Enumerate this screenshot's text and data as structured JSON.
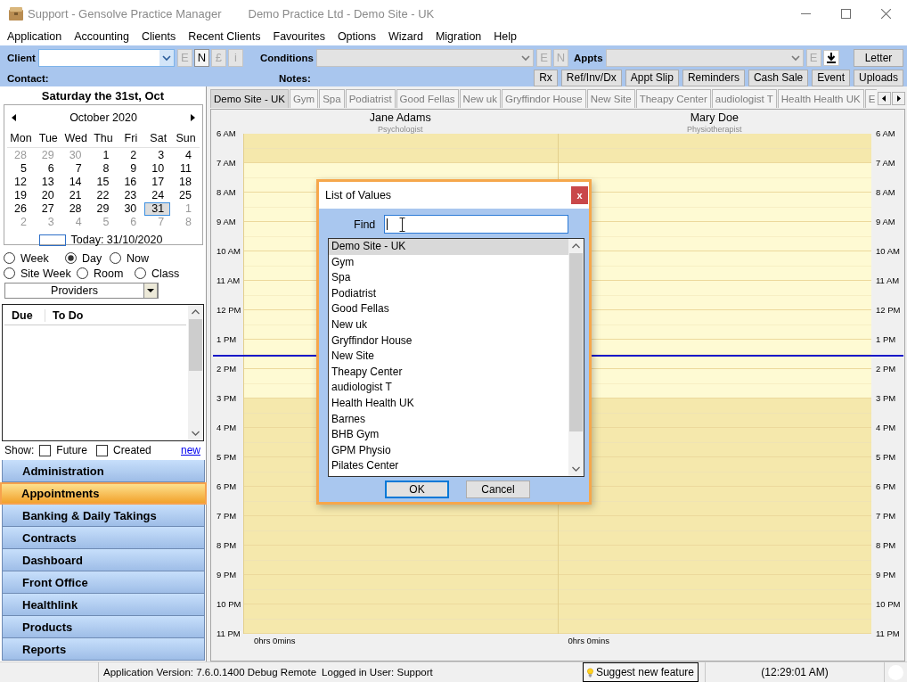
{
  "window": {
    "app_title": "Support - Gensolve Practice Manager",
    "document_title": "Demo Practice Ltd - Demo Site - UK"
  },
  "menu": [
    "Application",
    "Accounting",
    "Clients",
    "Recent Clients",
    "Favourites",
    "Options",
    "Wizard",
    "Migration",
    "Help"
  ],
  "toolbar": {
    "fields": [
      {
        "label": "Client",
        "disabled": false,
        "buttons": [
          {
            "label": "E",
            "disabled": true
          },
          {
            "label": "N",
            "disabled": false
          },
          {
            "label": "£",
            "disabled": true
          },
          {
            "label": "i",
            "disabled": true
          }
        ]
      },
      {
        "label": "Conditions",
        "disabled": true,
        "buttons": [
          {
            "label": "E",
            "disabled": true
          },
          {
            "label": "N",
            "disabled": true
          }
        ]
      },
      {
        "label": "Appts",
        "disabled": true,
        "buttons": [
          {
            "label": "E",
            "disabled": true
          }
        ]
      }
    ],
    "letter_button": "Letter",
    "contact_label": "Contact:",
    "notes_label": "Notes:",
    "actions": [
      "Rx",
      "Ref/Inv/Dx",
      "Appt Slip",
      "Reminders",
      "Cash Sale",
      "Event",
      "Uploads"
    ]
  },
  "date_heading": "Saturday the 31st, Oct",
  "calendar": {
    "month": "October 2020",
    "weekdays": [
      "Mon",
      "Tue",
      "Wed",
      "Thu",
      "Fri",
      "Sat",
      "Sun"
    ],
    "weeks": [
      [
        {
          "day": "28",
          "other_month": true,
          "selected": false
        },
        {
          "day": "29",
          "other_month": true,
          "selected": false
        },
        {
          "day": "30",
          "other_month": true,
          "selected": false
        },
        {
          "day": "1",
          "other_month": false,
          "selected": false
        },
        {
          "day": "2",
          "other_month": false,
          "selected": false
        },
        {
          "day": "3",
          "other_month": false,
          "selected": false
        },
        {
          "day": "4",
          "other_month": false,
          "selected": false
        }
      ],
      [
        {
          "day": "5",
          "other_month": false,
          "selected": false
        },
        {
          "day": "6",
          "other_month": false,
          "selected": false
        },
        {
          "day": "7",
          "other_month": false,
          "selected": false
        },
        {
          "day": "8",
          "other_month": false,
          "selected": false
        },
        {
          "day": "9",
          "other_month": false,
          "selected": false
        },
        {
          "day": "10",
          "other_month": false,
          "selected": false
        },
        {
          "day": "11",
          "other_month": false,
          "selected": false
        }
      ],
      [
        {
          "day": "12",
          "other_month": false,
          "selected": false
        },
        {
          "day": "13",
          "other_month": false,
          "selected": false
        },
        {
          "day": "14",
          "other_month": false,
          "selected": false
        },
        {
          "day": "15",
          "other_month": false,
          "selected": false
        },
        {
          "day": "16",
          "other_month": false,
          "selected": false
        },
        {
          "day": "17",
          "other_month": false,
          "selected": false
        },
        {
          "day": "18",
          "other_month": false,
          "selected": false
        }
      ],
      [
        {
          "day": "19",
          "other_month": false,
          "selected": false
        },
        {
          "day": "20",
          "other_month": false,
          "selected": false
        },
        {
          "day": "21",
          "other_month": false,
          "selected": false
        },
        {
          "day": "22",
          "other_month": false,
          "selected": false
        },
        {
          "day": "23",
          "other_month": false,
          "selected": false
        },
        {
          "day": "24",
          "other_month": false,
          "selected": false
        },
        {
          "day": "25",
          "other_month": false,
          "selected": false
        }
      ],
      [
        {
          "day": "26",
          "other_month": false,
          "selected": false
        },
        {
          "day": "27",
          "other_month": false,
          "selected": false
        },
        {
          "day": "28",
          "other_month": false,
          "selected": false
        },
        {
          "day": "29",
          "other_month": false,
          "selected": false
        },
        {
          "day": "30",
          "other_month": false,
          "selected": false
        },
        {
          "day": "31",
          "other_month": false,
          "selected": true
        },
        {
          "day": "1",
          "other_month": true,
          "selected": false
        }
      ],
      [
        {
          "day": "2",
          "other_month": true,
          "selected": false
        },
        {
          "day": "3",
          "other_month": true,
          "selected": false
        },
        {
          "day": "4",
          "other_month": true,
          "selected": false
        },
        {
          "day": "5",
          "other_month": true,
          "selected": false
        },
        {
          "day": "6",
          "other_month": true,
          "selected": false
        },
        {
          "day": "7",
          "other_month": true,
          "selected": false
        },
        {
          "day": "8",
          "other_month": true,
          "selected": false
        }
      ]
    ],
    "today_label": "Today: 31/10/2020"
  },
  "view_options": [
    [
      {
        "label": "Week",
        "selected": false
      },
      {
        "label": "Day",
        "selected": true
      },
      {
        "label": "Now",
        "selected": false
      }
    ],
    [
      {
        "label": "Site Week",
        "selected": false
      },
      {
        "label": "Room",
        "selected": false
      },
      {
        "label": "Class",
        "selected": false
      }
    ]
  ],
  "providers_dropdown": "Providers",
  "todo": {
    "columns": [
      "Due",
      "To Do"
    ]
  },
  "show_filter": {
    "label": "Show:",
    "options": [
      {
        "label": "Future",
        "checked": false
      },
      {
        "label": "Created",
        "checked": false
      }
    ],
    "link": "new"
  },
  "modules": [
    {
      "label": "Administration",
      "selected": false
    },
    {
      "label": "Appointments",
      "selected": true
    },
    {
      "label": "Banking & Daily Takings",
      "selected": false
    },
    {
      "label": "Contracts",
      "selected": false
    },
    {
      "label": "Dashboard",
      "selected": false
    },
    {
      "label": "Front Office",
      "selected": false
    },
    {
      "label": "Healthlink",
      "selected": false
    },
    {
      "label": "Products",
      "selected": false
    },
    {
      "label": "Reports",
      "selected": false
    }
  ],
  "site_tabs": [
    {
      "label": "Demo Site - UK",
      "selected": true
    },
    {
      "label": "Gym",
      "selected": false
    },
    {
      "label": "Spa",
      "selected": false
    },
    {
      "label": "Podiatrist",
      "selected": false
    },
    {
      "label": "Good Fellas",
      "selected": false
    },
    {
      "label": "New uk",
      "selected": false
    },
    {
      "label": "Gryffindor House",
      "selected": false
    },
    {
      "label": "New Site",
      "selected": false
    },
    {
      "label": "Theapy Center",
      "selected": false
    },
    {
      "label": "audiologist T",
      "selected": false
    },
    {
      "label": "Health Health UK",
      "selected": false
    },
    {
      "label": "E",
      "selected": false
    }
  ],
  "schedule": {
    "providers": [
      {
        "name": "Jane Adams",
        "role": "Psychologist",
        "total": "0hrs 0mins"
      },
      {
        "name": "Mary Doe",
        "role": "Physiotherapist",
        "total": "0hrs 0mins"
      }
    ],
    "hours_left": [
      "6 AM",
      "7 AM",
      "8 AM",
      "9 AM",
      "10 AM",
      "11 AM",
      "12 PM",
      "1 PM",
      "2 PM",
      "3 PM",
      "4 PM",
      "5 PM",
      "6 PM",
      "7 PM",
      "8 PM",
      "9 PM",
      "10 PM",
      "11 PM"
    ],
    "hours_right": [
      "6 AM",
      "7 AM",
      "8 AM",
      "9 AM",
      "10 AM",
      "11 AM",
      "12 PM",
      "1 PM",
      "2 PM",
      "3 PM",
      "4 PM",
      "5 PM",
      "6 PM",
      "7 PM",
      "8 PM",
      "9 PM",
      "10 PM",
      "11 PM"
    ],
    "slots": [
      {
        "available": false,
        "current": false
      },
      {
        "available": true,
        "current": false
      },
      {
        "available": true,
        "current": false
      },
      {
        "available": true,
        "current": false
      },
      {
        "available": true,
        "current": false
      },
      {
        "available": true,
        "current": false
      },
      {
        "available": true,
        "current": false
      },
      {
        "available": true,
        "current": true
      },
      {
        "available": true,
        "current": false
      },
      {
        "available": false,
        "current": false
      },
      {
        "available": false,
        "current": false
      },
      {
        "available": false,
        "current": false
      },
      {
        "available": false,
        "current": false
      },
      {
        "available": false,
        "current": false
      },
      {
        "available": false,
        "current": false
      },
      {
        "available": false,
        "current": false
      },
      {
        "available": false,
        "current": false
      }
    ]
  },
  "dialog": {
    "title": "List of Values",
    "close": "x",
    "find_label": "Find",
    "items": [
      {
        "label": "Demo Site - UK",
        "selected": true
      },
      {
        "label": "Gym",
        "selected": false
      },
      {
        "label": "Spa",
        "selected": false
      },
      {
        "label": "Podiatrist",
        "selected": false
      },
      {
        "label": "Good Fellas",
        "selected": false
      },
      {
        "label": "New uk",
        "selected": false
      },
      {
        "label": "Gryffindor House",
        "selected": false
      },
      {
        "label": "New Site",
        "selected": false
      },
      {
        "label": "Theapy Center",
        "selected": false
      },
      {
        "label": "audiologist T",
        "selected": false
      },
      {
        "label": "Health Health UK",
        "selected": false
      },
      {
        "label": "Barnes",
        "selected": false
      },
      {
        "label": "BHB Gym",
        "selected": false
      },
      {
        "label": "GPM Physio",
        "selected": false
      },
      {
        "label": "Pilates Center",
        "selected": false
      }
    ],
    "buttons": [
      {
        "label": "OK",
        "default": true
      },
      {
        "label": "Cancel",
        "default": false
      }
    ]
  },
  "status_bar": {
    "version": "Application Version: 7.6.0.1400 Debug Remote",
    "user": "Logged in User: Support",
    "suggest_button": "Suggest new feature",
    "time": "(12:29:01 AM)"
  }
}
